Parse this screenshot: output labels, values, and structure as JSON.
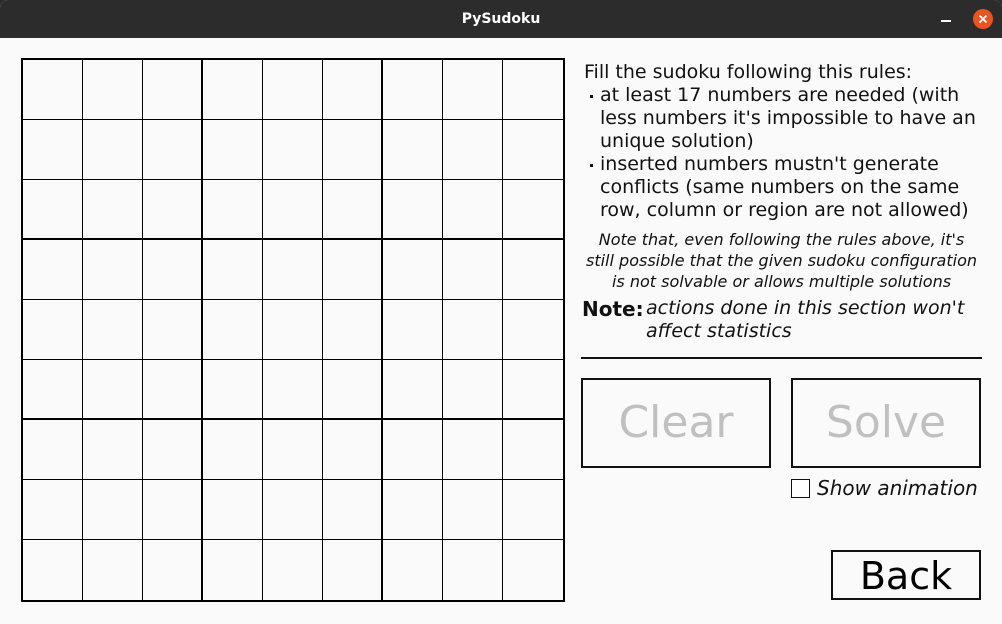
{
  "window": {
    "title": "PySudoku"
  },
  "board": {
    "rows": 9,
    "cols": 9,
    "values": []
  },
  "rules": {
    "heading": "Fill the sudoku following this rules:",
    "items": [
      "at least 17 numbers are needed (with less numbers it's impossible to have an unique solution)",
      "inserted numbers mustn't generate conflicts (same numbers on the same row, column or region are not allowed)"
    ],
    "italic_note": "Note that, even following the rules above, it's still possible that the given sudoku configuration is not solvable or allows multiple solutions"
  },
  "note": {
    "label": "Note:",
    "text": "actions done in this section won't affect statistics"
  },
  "actions": {
    "clear_label": "Clear",
    "solve_label": "Solve",
    "show_animation_label": "Show animation",
    "show_animation_checked": false,
    "back_label": "Back"
  },
  "colors": {
    "titlebar": "#2c2c2c",
    "close_button": "#e95420",
    "disabled_text": "#c0c0c0"
  }
}
